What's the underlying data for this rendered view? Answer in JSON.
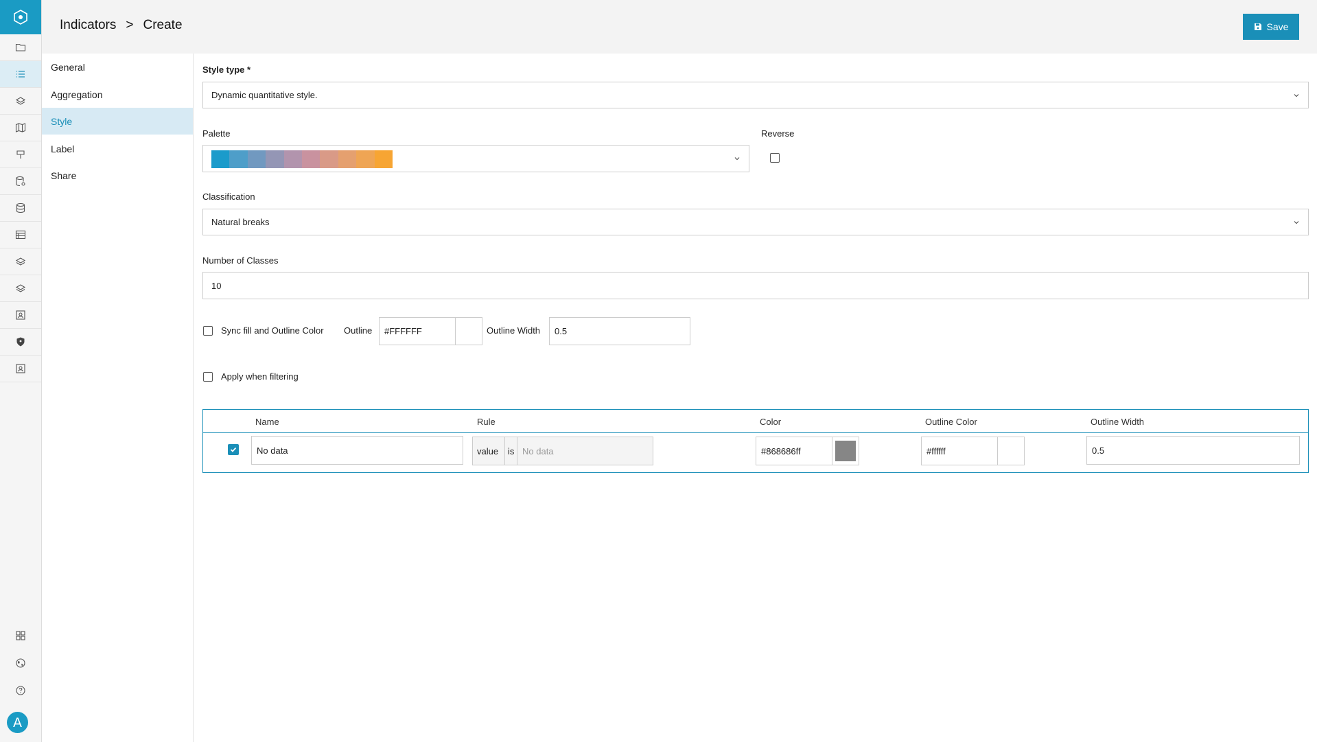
{
  "header": {
    "breadcrumb_parent": "Indicators",
    "breadcrumb_separator": ">",
    "breadcrumb_current": "Create",
    "save_label": "Save"
  },
  "rail": {
    "avatar_letter": "A"
  },
  "subnav": {
    "items": [
      "General",
      "Aggregation",
      "Style",
      "Label",
      "Share"
    ],
    "active": "Style"
  },
  "form": {
    "style_type_label": "Style type *",
    "style_type_value": "Dynamic quantitative style.",
    "palette_label": "Palette",
    "palette_colors": [
      "#1b9bcb",
      "#4e9ec9",
      "#7199c0",
      "#9496b5",
      "#b294ad",
      "#c9929f",
      "#d99a87",
      "#e5a06f",
      "#efa554",
      "#f7a533"
    ],
    "reverse_label": "Reverse",
    "classification_label": "Classification",
    "classification_value": "Natural breaks",
    "num_classes_label": "Number of Classes",
    "num_classes_value": "10",
    "sync_label": "Sync fill and Outline Color",
    "outline_label": "Outline",
    "outline_value": "#FFFFFF",
    "outline_width_label": "Outline Width",
    "outline_width_value": "0.5",
    "apply_filter_label": "Apply when filtering"
  },
  "table": {
    "headers": {
      "name": "Name",
      "rule": "Rule",
      "color": "Color",
      "outline_color": "Outline Color",
      "outline_width": "Outline Width"
    },
    "row": {
      "name": "No data",
      "rule_field": "value",
      "rule_op": "is",
      "rule_value_placeholder": "No data",
      "color": "#868686ff",
      "color_swatch": "#868686",
      "outline_color": "#ffffff",
      "outline_width": "0.5"
    }
  }
}
